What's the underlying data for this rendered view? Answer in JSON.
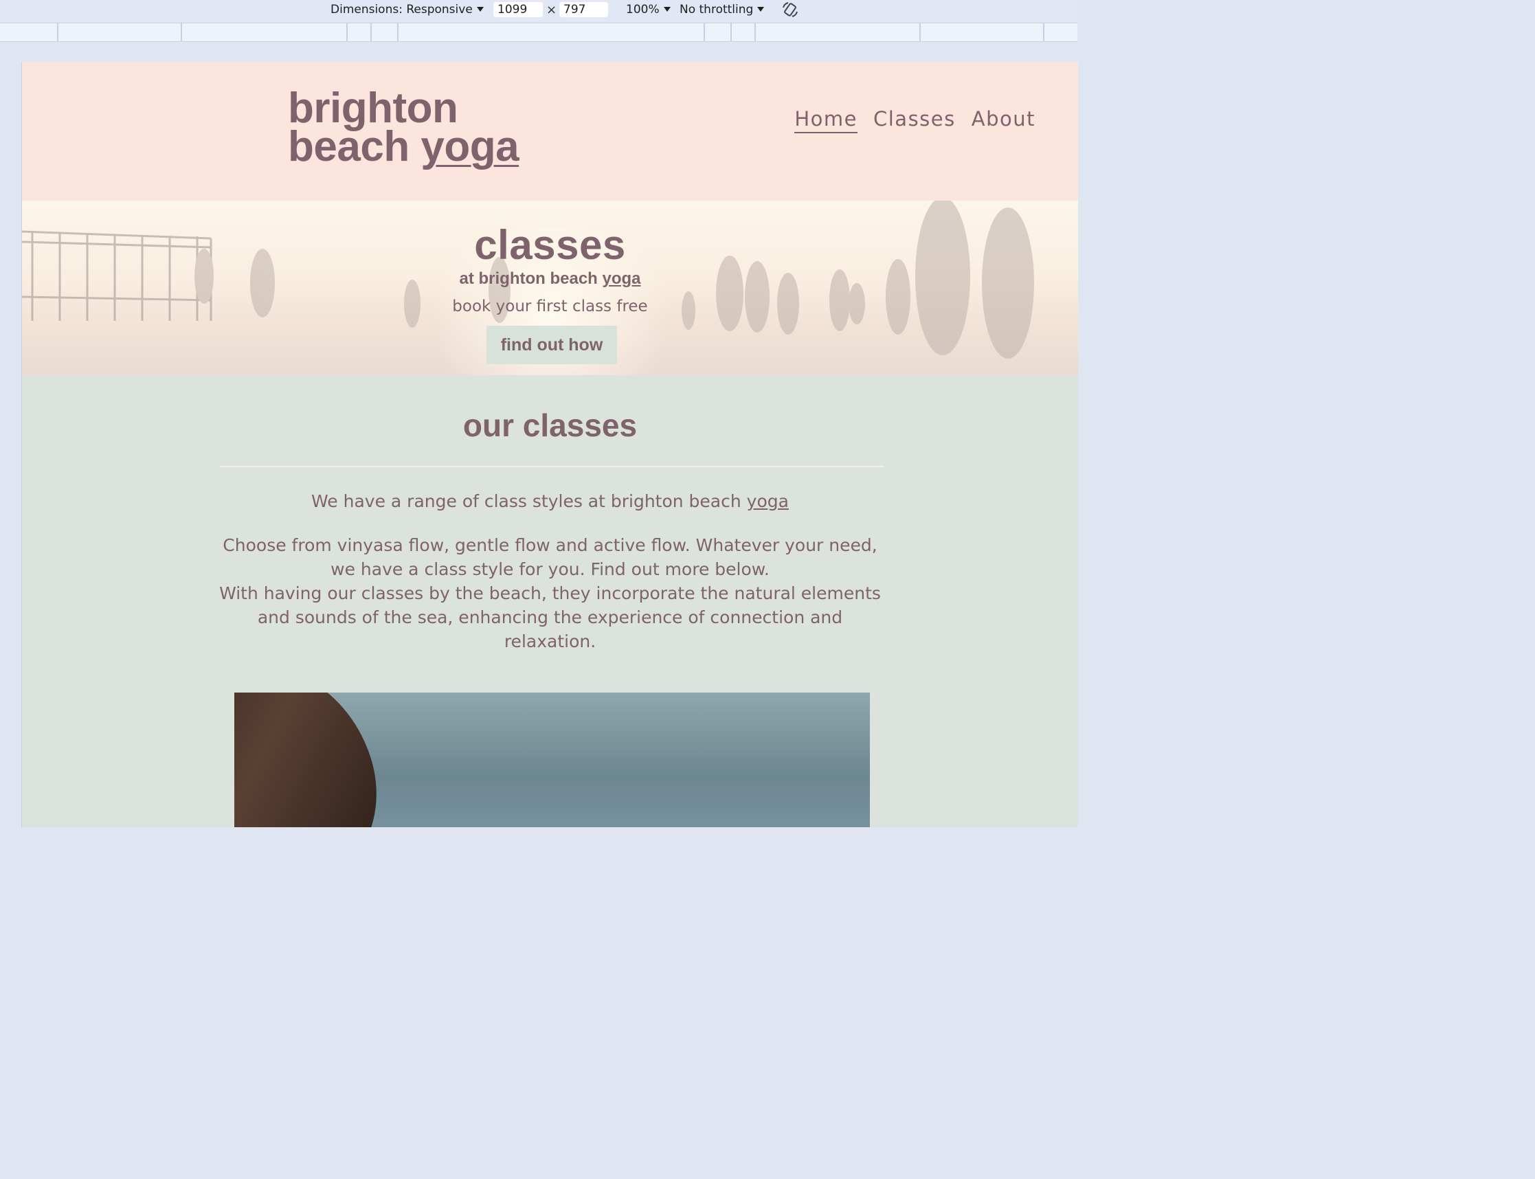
{
  "devtools": {
    "dimensions_label": "Dimensions: Responsive",
    "width": "1099",
    "height": "797",
    "times": "×",
    "zoom": "100%",
    "throttling": "No throttling",
    "rotate_icon": "rotate-icon"
  },
  "site": {
    "logo_line1": "brighton",
    "logo_line2_a": "beach ",
    "logo_line2_b": "yoga",
    "nav": [
      "Home",
      "Classes",
      "About"
    ],
    "nav_active": "Home",
    "hero": {
      "title": "classes",
      "subtitle_a": "at brighton beach ",
      "subtitle_b": "yoga",
      "text": "book your first class free",
      "button": "find out how"
    },
    "section": {
      "title": "our classes",
      "intro_a": "We have a range of class styles at brighton beach ",
      "intro_b": "yoga",
      "body_line1": "Choose from vinyasa flow, gentle flow and active flow. Whatever your need, we have a class style for you. Find out more below.",
      "body_line2": "With having our classes by the beach, they incorporate the natural elements and sounds of the sea, enhancing the experience of connection and relaxation."
    }
  },
  "colors": {
    "text": "#7e626c",
    "header_bg": "#fbe5dc",
    "section_bg": "#dbe3dc"
  }
}
